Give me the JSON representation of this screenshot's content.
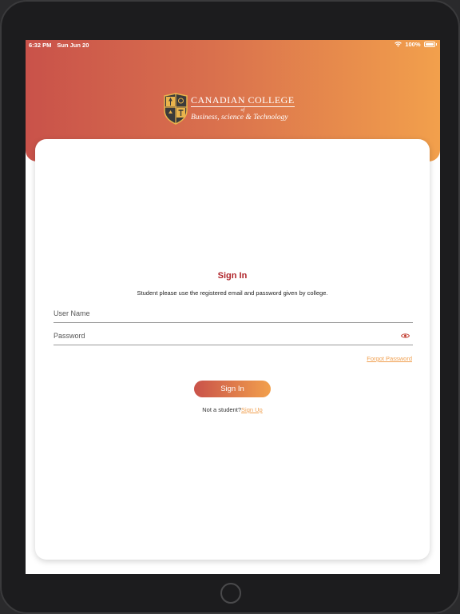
{
  "status_bar": {
    "time": "6:32 PM",
    "date": "Sun Jun 20",
    "battery": "100%"
  },
  "logo": {
    "title": "CANADIAN COLLEGE",
    "of": "of",
    "subtitle": "Business, science & Technology"
  },
  "login": {
    "title": "Sign In",
    "instruction": "Student please use the registered email and password given by college.",
    "username_placeholder": "User Name",
    "password_placeholder": "Password",
    "forgot_password": "Forgot Password",
    "signin_button": "Sign In",
    "not_student": "Not a student?",
    "signup_link": "Sign Up"
  },
  "colors": {
    "accent_red": "#b0242a",
    "gradient_start": "#c9524a",
    "gradient_end": "#f2a04c",
    "link_orange": "#f0a050"
  }
}
